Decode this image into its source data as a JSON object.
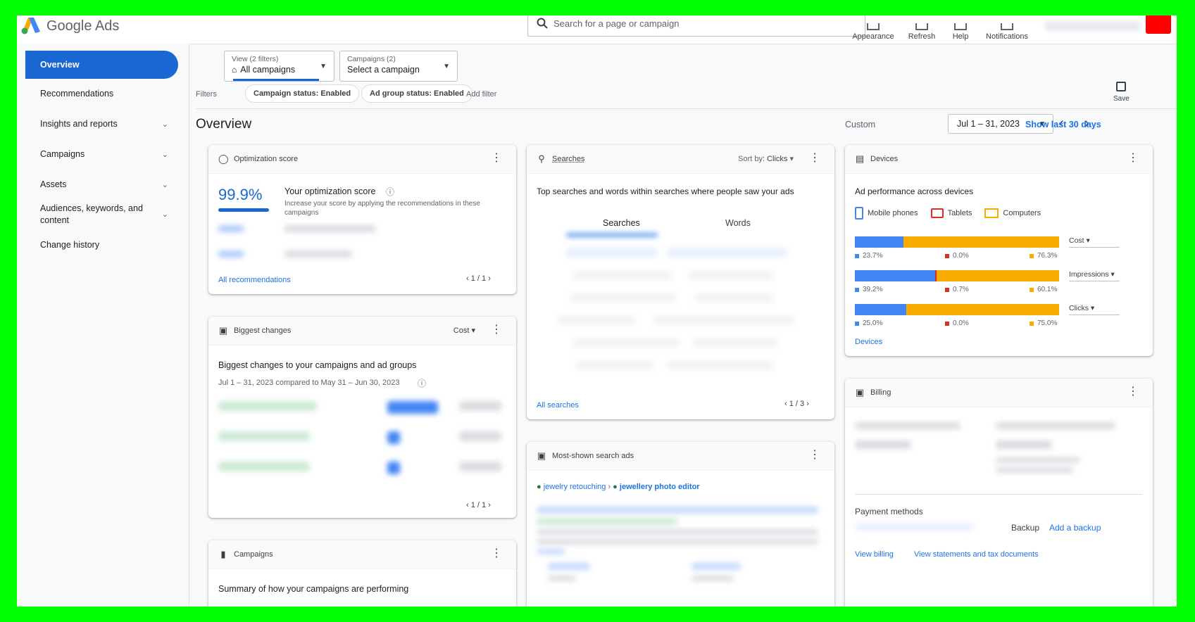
{
  "app": {
    "name": "Google Ads"
  },
  "search": {
    "placeholder": "Search for a page or campaign"
  },
  "toolbar": {
    "appearance": "Appearance",
    "refresh": "Refresh",
    "help": "Help",
    "notifications": "Notifications"
  },
  "colors": {
    "accent": "#1967d2",
    "link": "#1a73e8",
    "blue": "#4285f4",
    "red": "#d93025",
    "yellow": "#f9ab00"
  },
  "sidebar": {
    "items": [
      {
        "label": "Overview",
        "active": true
      },
      {
        "label": "Recommendations"
      },
      {
        "label": "Insights and reports",
        "expand": true
      },
      {
        "label": "Campaigns",
        "expand": true
      },
      {
        "label": "Assets",
        "expand": true
      },
      {
        "label": "Audiences, keywords, and content",
        "expand": true
      },
      {
        "label": "Change history"
      }
    ]
  },
  "view_dd": {
    "label": "View (2 filters)",
    "value": "All campaigns"
  },
  "campaigns_dd": {
    "label": "Campaigns (2)",
    "value": "Select a campaign"
  },
  "filters": {
    "label": "Filters",
    "chips": [
      "Campaign status: Enabled",
      "Ad group status: Enabled"
    ],
    "add": "Add filter"
  },
  "save": {
    "label": "Save"
  },
  "overview": {
    "title": "Overview",
    "custom": "Custom",
    "date_range": "Jul 1 – 31, 2023",
    "show_last": "Show last 30 days"
  },
  "opt": {
    "title": "Optimization score",
    "score": "99.9%",
    "score_value": 0.999,
    "heading": "Your optimization score",
    "desc": "Increase your score by applying the recommendations in these campaigns",
    "all": "All recommendations",
    "pager": "1 / 1"
  },
  "changes": {
    "title": "Biggest changes",
    "sort": "Cost",
    "heading": "Biggest changes to your campaigns and ad groups",
    "sub": "Jul 1 – 31, 2023 compared to May 31 – Jun 30, 2023",
    "pager": "1 / 1"
  },
  "camps": {
    "title": "Campaigns",
    "heading": "Summary of how your campaigns are performing"
  },
  "searches": {
    "title": "Searches",
    "sort_label": "Sort by:",
    "sort_value": "Clicks",
    "desc": "Top searches and words within searches where people saw your ads",
    "tab1": "Searches",
    "tab2": "Words",
    "all": "All searches",
    "pager": "1 / 3"
  },
  "most": {
    "title": "Most-shown search ads",
    "bc1": "jewelry retouching",
    "bc2": "jewellery photo editor"
  },
  "devices": {
    "title": "Devices",
    "heading": "Ad performance across devices",
    "legend": [
      "Mobile phones",
      "Tablets",
      "Computers"
    ],
    "rows": [
      {
        "metric": "Cost",
        "m": "23.7%",
        "t": "0.0%",
        "c": "76.3%",
        "mv": 23.7,
        "tv": 0.0,
        "cv": 76.3
      },
      {
        "metric": "Impressions",
        "m": "39.2%",
        "t": "0.7%",
        "c": "60.1%",
        "mv": 39.2,
        "tv": 0.7,
        "cv": 60.1
      },
      {
        "metric": "Clicks",
        "m": "25.0%",
        "t": "0.0%",
        "c": "75.0%",
        "mv": 25.0,
        "tv": 0.0,
        "cv": 75.0
      }
    ],
    "link": "Devices"
  },
  "billing": {
    "title": "Billing",
    "payment": "Payment methods",
    "backup": "Backup",
    "add_backup": "Add a backup",
    "view_billing": "View billing",
    "statements": "View statements and tax documents"
  }
}
